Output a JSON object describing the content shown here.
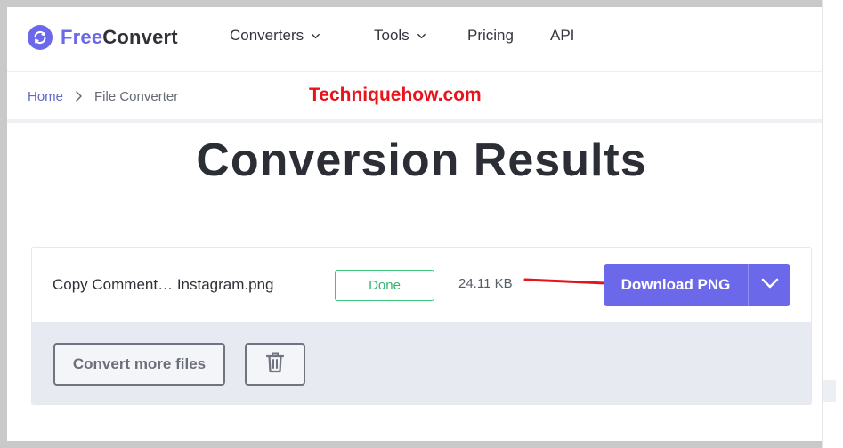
{
  "header": {
    "logo": {
      "part1": "Free",
      "part2": "Convert"
    },
    "nav": [
      {
        "label": "Converters",
        "has_dropdown": true
      },
      {
        "label": "Tools",
        "has_dropdown": true
      },
      {
        "label": "Pricing",
        "has_dropdown": false
      },
      {
        "label": "API",
        "has_dropdown": false
      }
    ]
  },
  "breadcrumb": {
    "home": "Home",
    "current": "File Converter"
  },
  "watermark": "Techniquehow.com",
  "page_title": "Conversion Results",
  "result": {
    "file_name": "Copy Comment… Instagram.png",
    "status": "Done",
    "size": "24.11 KB",
    "download_label": "Download PNG"
  },
  "actions": {
    "convert_more": "Convert more files"
  },
  "icons": {
    "logo": "refresh-icon",
    "nav_dropdown": "chevron-down-icon",
    "breadcrumb_sep": "chevron-right-icon",
    "download_toggle": "chevron-down-icon",
    "delete": "trash-icon",
    "annotation": "red-arrow-icon"
  },
  "colors": {
    "brand": "#6b68e9",
    "status": "#3ec47a",
    "watermark": "#e8141b",
    "action_area": "#e8eaf2"
  }
}
